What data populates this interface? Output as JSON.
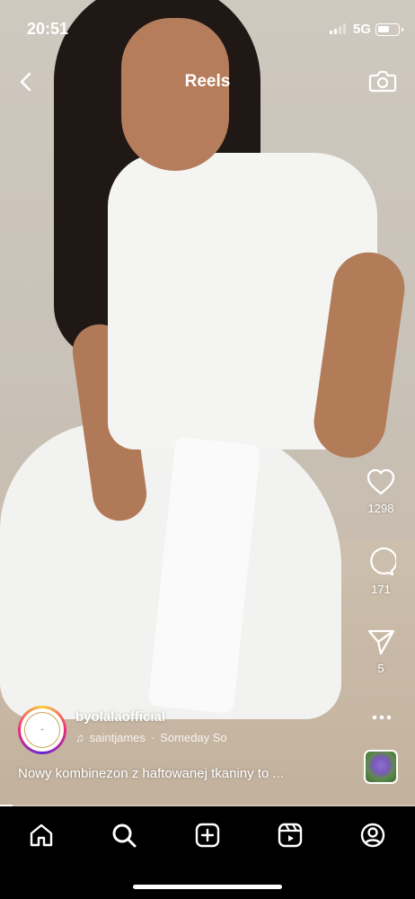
{
  "status_bar": {
    "time": "20:51",
    "network": "5G",
    "signal_bars_active": 2,
    "signal_bars_total": 4,
    "battery_level": 0.6
  },
  "header": {
    "title": "Reels",
    "back_icon": "chevron-left-icon",
    "camera_icon": "camera-icon"
  },
  "actions": {
    "like": {
      "icon": "heart-icon",
      "count": "1298"
    },
    "comment": {
      "icon": "comment-bubble-icon",
      "count": "171"
    },
    "share": {
      "icon": "paper-plane-icon",
      "count": "5"
    },
    "more_icon": "more-horizontal-icon"
  },
  "post": {
    "username": "byolalaofficial",
    "music_artist": "saintjames",
    "music_separator": "·",
    "music_track": "Someday So",
    "caption": "Nowy kombinezon z haftowanej tkaniny to ...",
    "progress": 0.03
  },
  "nav": {
    "items": [
      {
        "name": "home",
        "icon": "home-icon"
      },
      {
        "name": "search",
        "icon": "search-icon"
      },
      {
        "name": "create",
        "icon": "plus-square-icon"
      },
      {
        "name": "reels",
        "icon": "reels-icon"
      },
      {
        "name": "profile",
        "icon": "profile-icon"
      }
    ]
  },
  "colors": {
    "text": "#ffffff",
    "nav_background": "#000000"
  }
}
